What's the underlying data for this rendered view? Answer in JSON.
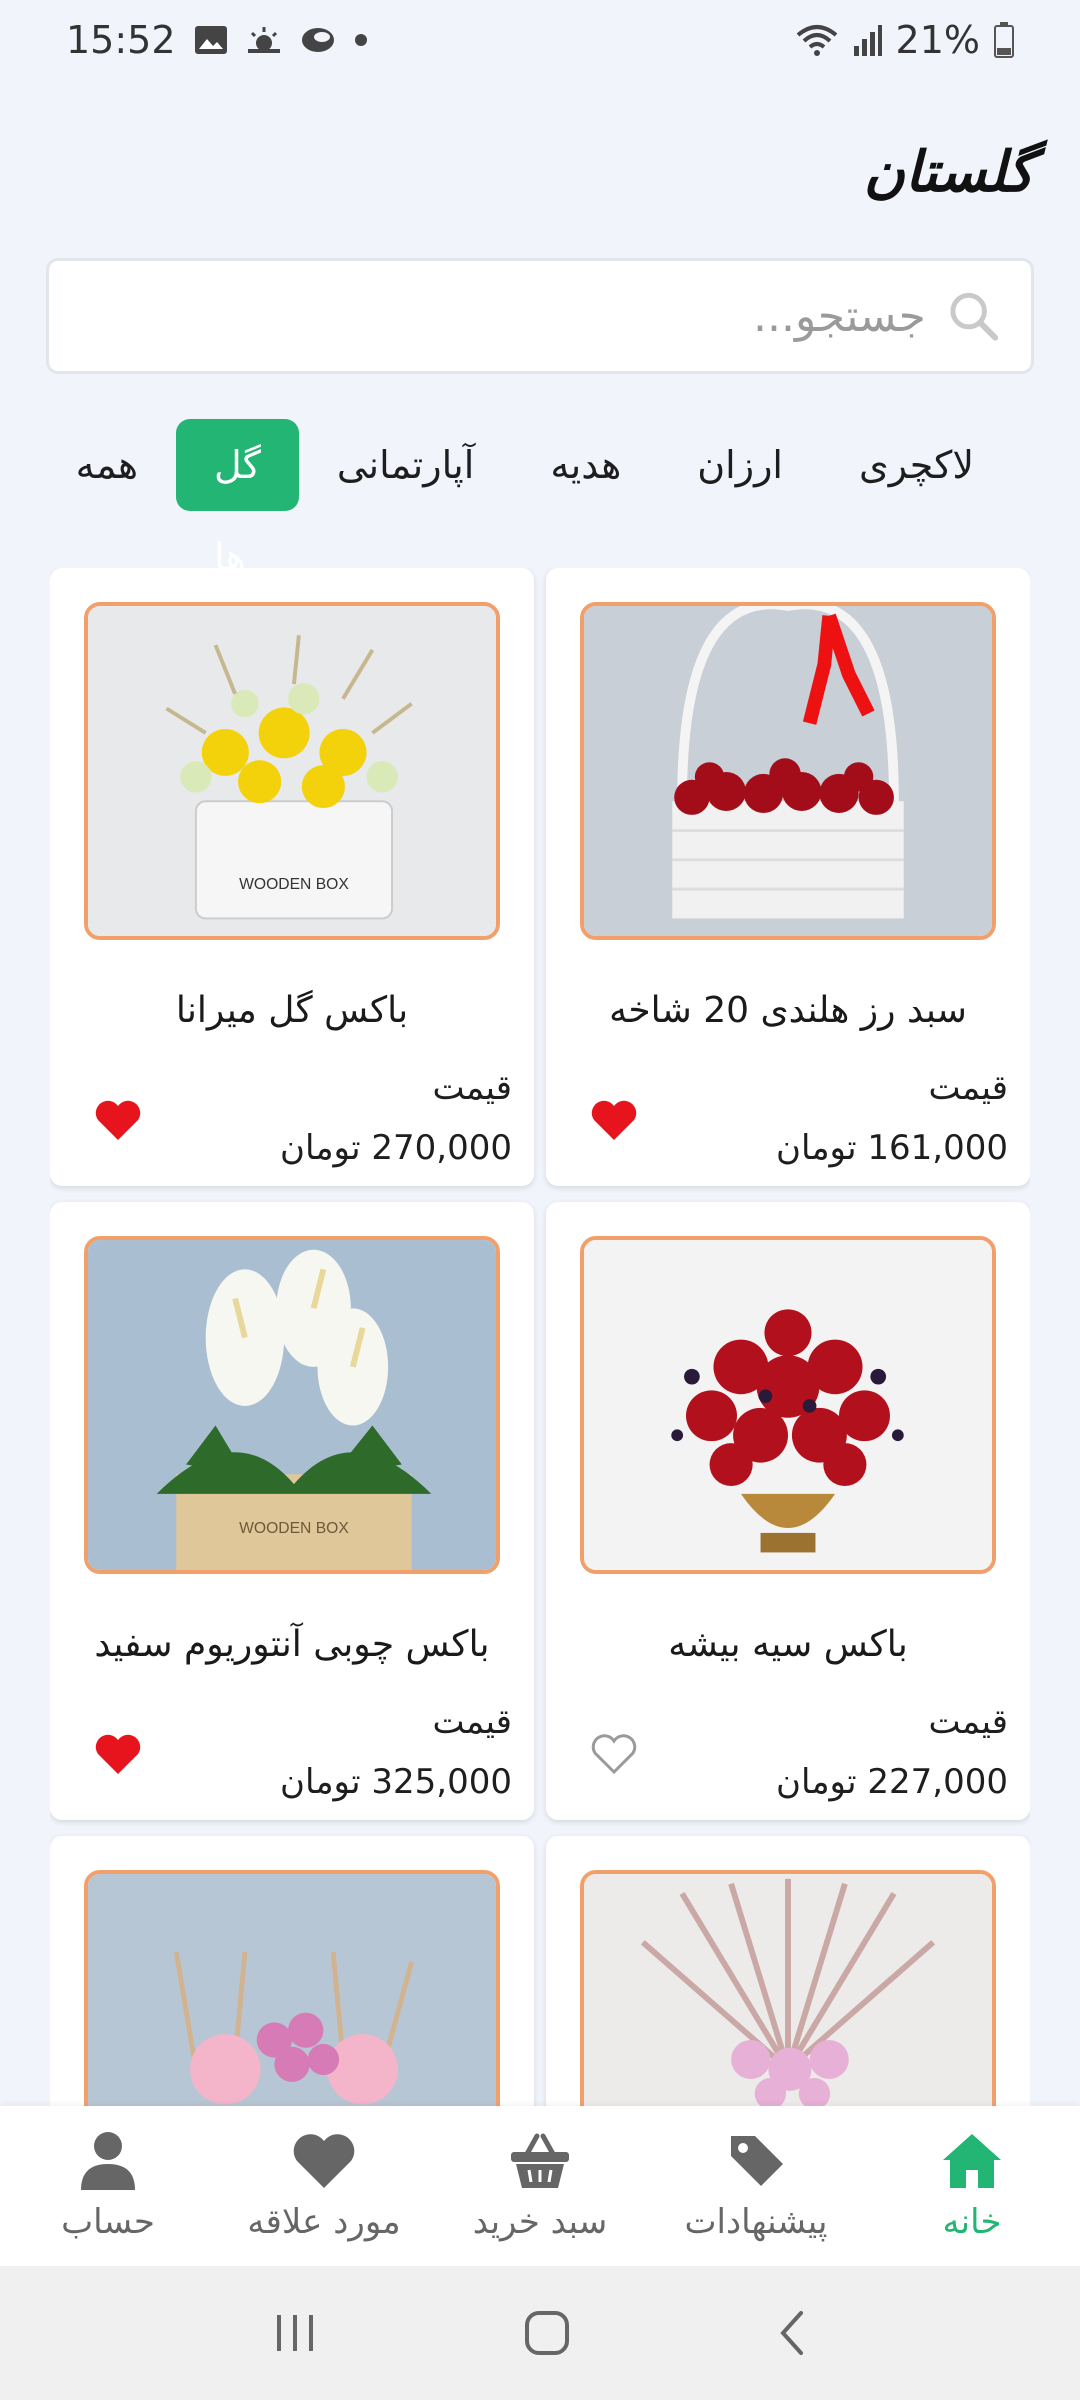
{
  "status_bar": {
    "time": "15:52",
    "battery": "21%"
  },
  "app": {
    "title": "گلستان"
  },
  "search": {
    "placeholder": "جستجو..."
  },
  "categories": [
    "لاکچری",
    "ارزان",
    "هدیه",
    "آپارتمانی",
    "گل ها",
    "همه"
  ],
  "active_category": "گل ها",
  "products": [
    {
      "name": "سبد رز هلندی 20 شاخه",
      "price_label": "قیمت",
      "price": "161,000 تومان",
      "favorite": true
    },
    {
      "name": "باکس گل میرانا",
      "price_label": "قیمت",
      "price": "270,000 تومان",
      "favorite": true
    },
    {
      "name": "باکس سیه بیشه",
      "price_label": "قیمت",
      "price": "227,000 تومان",
      "favorite": false
    },
    {
      "name": "باکس چوبی آنتوریوم سفید",
      "price_label": "قیمت",
      "price": "325,000 تومان",
      "favorite": true
    }
  ],
  "bottom_nav": {
    "home": "خانه",
    "offers": "پیشنهادات",
    "cart": "سبد خرید",
    "favorites": "مورد علاقه",
    "account": "حساب"
  },
  "colors": {
    "accent": "#22B573",
    "heart": "#E8141D",
    "background": "#F1F4FB"
  }
}
